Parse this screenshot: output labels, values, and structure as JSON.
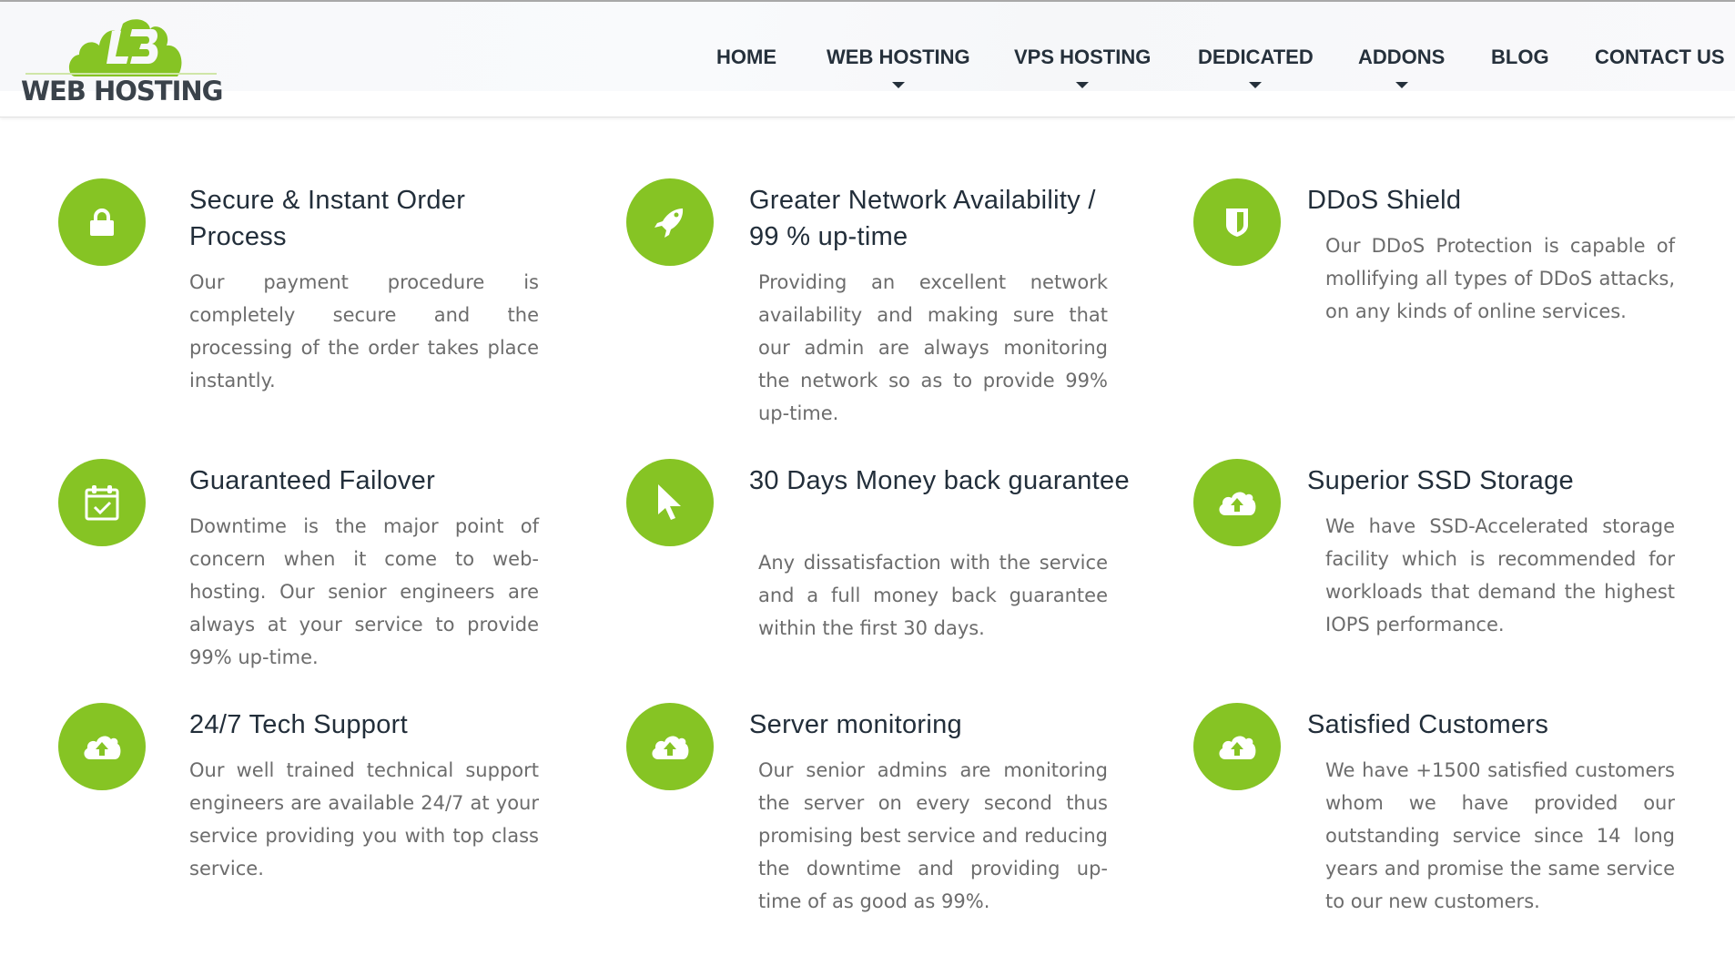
{
  "brand": {
    "logo_mark": "L3",
    "logo_text": "WEB HOSTING",
    "accent_color": "#86c424",
    "text_dark": "#222e3a"
  },
  "nav": {
    "items": [
      {
        "label": "HOME",
        "has_dropdown": false
      },
      {
        "label": "WEB HOSTING",
        "has_dropdown": true
      },
      {
        "label": "VPS HOSTING",
        "has_dropdown": true
      },
      {
        "label": "DEDICATED",
        "has_dropdown": true
      },
      {
        "label": "ADDONS",
        "has_dropdown": true
      },
      {
        "label": "BLOG",
        "has_dropdown": false
      },
      {
        "label": "CONTACT US",
        "has_dropdown": false
      }
    ]
  },
  "features": [
    {
      "icon": "lock-icon",
      "title": "Secure & Instant Order Process",
      "description": "Our payment procedure is completely secure and the processing of the order takes place instantly."
    },
    {
      "icon": "rocket-icon",
      "title": "Greater Network Availability / 99 % up-time",
      "description": "Providing an excellent network availability and making sure that our admin are always monitoring the network so as to provide 99% up-time."
    },
    {
      "icon": "shield-icon",
      "title": "DDoS Shield",
      "description": "Our DDoS Protection is capable of mollifying all types of DDoS attacks, on any kinds of online services."
    },
    {
      "icon": "calendar-check-icon",
      "title": "Guaranteed Failover",
      "description": "Downtime is the major point of concern when it come to web-hosting. Our senior engineers are always at your service to provide 99% up-time."
    },
    {
      "icon": "cursor-pointer-icon",
      "title": "30 Days Money back guarantee",
      "description": "Any dissatisfaction with the service and a full money back guarantee within the first 30 days."
    },
    {
      "icon": "cloud-upload-icon",
      "title": "Superior SSD Storage",
      "description": "We have SSD-Accelerated storage facility which is recommended for workloads that demand the highest IOPS performance."
    },
    {
      "icon": "cloud-upload-icon",
      "title": "24/7 Tech Support",
      "description": "Our well trained technical support engineers are available 24/7 at your service providing you with top class service."
    },
    {
      "icon": "cloud-upload-icon",
      "title": "Server monitoring",
      "description": "Our senior admins are monitoring the server on every second thus promising best service and reducing the downtime and providing up-time of as good as 99%."
    },
    {
      "icon": "cloud-upload-icon",
      "title": "Satisfied Customers",
      "description": "We have +1500 satisfied customers whom we have provided our outstanding service since 14 long years and promise the same service to our new customers."
    }
  ]
}
